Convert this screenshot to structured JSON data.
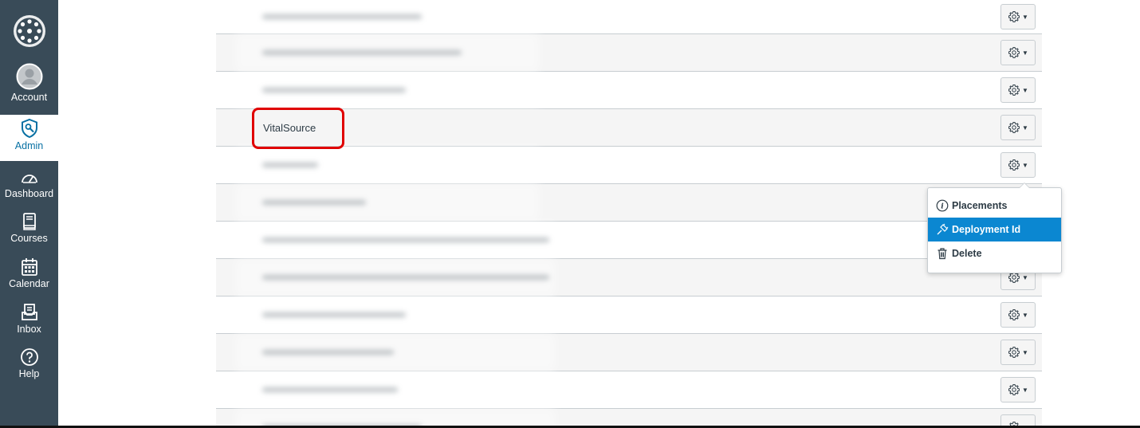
{
  "nav": {
    "items": [
      {
        "label": "Account",
        "icon": "avatar-icon"
      },
      {
        "label": "Admin",
        "icon": "shield-icon",
        "active": true
      },
      {
        "label": "Dashboard",
        "icon": "speedometer-icon"
      },
      {
        "label": "Courses",
        "icon": "book-icon"
      },
      {
        "label": "Calendar",
        "icon": "calendar-icon"
      },
      {
        "label": "Inbox",
        "icon": "inbox-icon"
      },
      {
        "label": "Help",
        "icon": "help-icon"
      }
    ],
    "colors": {
      "background": "#394b58",
      "active_text": "#0770a3"
    }
  },
  "table": {
    "rows": [
      {
        "name": "",
        "blurred": true
      },
      {
        "name": "",
        "blurred": true
      },
      {
        "name": "",
        "blurred": true
      },
      {
        "name": "VitalSource",
        "blurred": false,
        "highlighted": true
      },
      {
        "name": "",
        "blurred": true
      },
      {
        "name": "",
        "blurred": true
      },
      {
        "name": "",
        "blurred": true
      },
      {
        "name": "",
        "blurred": true
      },
      {
        "name": "",
        "blurred": true
      },
      {
        "name": "",
        "blurred": true
      },
      {
        "name": "",
        "blurred": true
      },
      {
        "name": "",
        "blurred": true
      }
    ]
  },
  "menu": {
    "items": [
      {
        "label": "Placements",
        "icon": "info-icon"
      },
      {
        "label": "Deployment Id",
        "icon": "plug-icon",
        "active": true
      },
      {
        "label": "Delete",
        "icon": "trash-icon"
      }
    ],
    "colors": {
      "active_bg": "#0b87d1",
      "highlight": "#e00000"
    }
  }
}
